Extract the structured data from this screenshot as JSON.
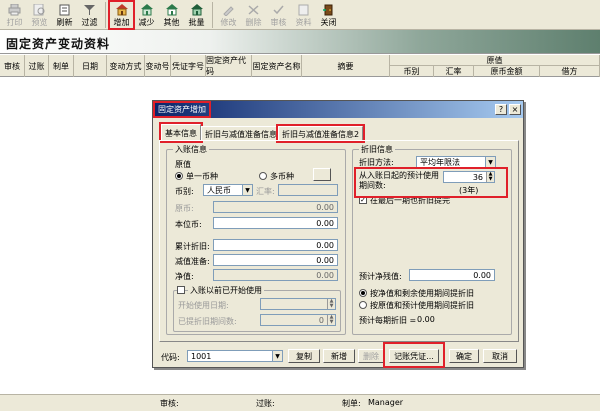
{
  "toolbar": {
    "buttons": [
      {
        "label": "打印",
        "icon": "printer-icon",
        "enabled": false
      },
      {
        "label": "预览",
        "icon": "preview-icon",
        "enabled": false
      },
      {
        "label": "刷新",
        "icon": "refresh-icon",
        "enabled": true
      },
      {
        "label": "过滤",
        "icon": "filter-icon",
        "enabled": true
      },
      {
        "label": "增加",
        "icon": "add-house-icon",
        "enabled": true
      },
      {
        "label": "减少",
        "icon": "reduce-house-icon",
        "enabled": true
      },
      {
        "label": "其他",
        "icon": "other-house-icon",
        "enabled": true
      },
      {
        "label": "批量",
        "icon": "batch-house-icon",
        "enabled": true
      },
      {
        "label": "修改",
        "icon": "edit-icon",
        "enabled": false
      },
      {
        "label": "删除",
        "icon": "delete-icon",
        "enabled": false
      },
      {
        "label": "审核",
        "icon": "audit-icon",
        "enabled": false
      },
      {
        "label": "资料",
        "icon": "data-icon",
        "enabled": false
      },
      {
        "label": "关闭",
        "icon": "close-door-icon",
        "enabled": true
      }
    ]
  },
  "banner": {
    "title": "固定资产变动资料"
  },
  "grid": {
    "columns": [
      "审核",
      "过账",
      "制单",
      "日期",
      "变动方式",
      "变动号",
      "凭证字号",
      "固定资产代码",
      "固定资产名称",
      "摘要"
    ],
    "group_header": "原值",
    "sub_columns": [
      "币别",
      "汇率",
      "原币金额",
      "借方"
    ]
  },
  "dialog": {
    "title": "固定资产增加",
    "tabs": [
      "基本信息",
      "折旧与减值准备信息1",
      "折旧与减值准备信息2"
    ],
    "left_group": {
      "title": "入账信息",
      "original_value_label": "原值",
      "single_currency": "单一币种",
      "multi_currency": "多币种",
      "currency_label": "币别:",
      "currency_value": "人民币",
      "rate_label": "汇率:",
      "orig_currency_label": "原币:",
      "orig_currency_value": "0.00",
      "base_currency_label": "本位币:",
      "base_currency_value": "0.00",
      "accum_depr_label": "累计折旧:",
      "accum_depr_value": "0.00",
      "impairment_label": "减值准备:",
      "impairment_value": "0.00",
      "net_value_label": "净值:",
      "net_value_value": "0.00",
      "prior_use_check": "入账以前已开始使用",
      "start_date_label": "开始使用日期:",
      "depr_periods_label": "已提折旧期间数:",
      "depr_periods_value": "0"
    },
    "right_group": {
      "title": "折旧信息",
      "method_label": "折旧方法:",
      "method_value": "平均年限法",
      "life_label": "从入账日起的预计使用期间数:",
      "life_value": "36",
      "life_years": "(3年)",
      "last_period_check": "在最后一期也折旧提完",
      "salvage_label": "预计净残值:",
      "salvage_value": "0.00",
      "opt_remaining": "按净值和剩余使用期间提折旧",
      "opt_original": "按原值和预计使用期间提折旧",
      "monthly_label": "预计每期折旧 =",
      "monthly_value": "0.00"
    },
    "footer": {
      "code_label": "代码:",
      "code_value": "1001",
      "copy_btn": "复制",
      "new_btn": "新增",
      "delete_btn": "删除",
      "voucher_btn": "记账凭证...",
      "ok_btn": "确定",
      "cancel_btn": "取消"
    }
  },
  "status": {
    "audit": "审核:",
    "post": "过账:",
    "maker": "制单:",
    "maker_name": "Manager"
  }
}
